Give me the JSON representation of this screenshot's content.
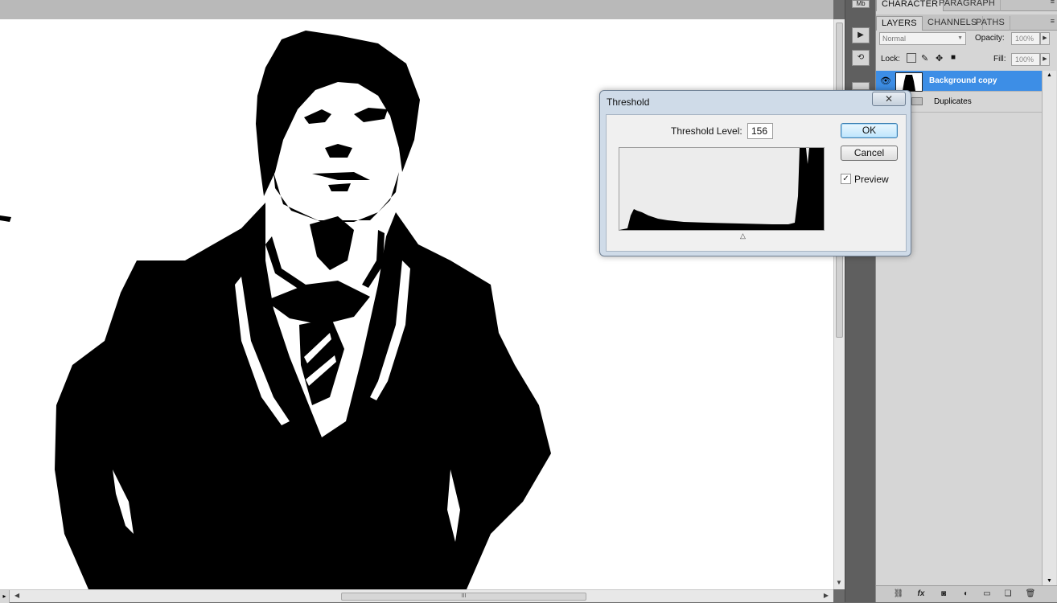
{
  "canvas": {
    "image_description_icon": "portrait-image"
  },
  "dock": {
    "icons": [
      "mini-bridge-icon",
      "play-icon",
      "history-icon",
      "layers-comp-icon"
    ]
  },
  "top_panel": {
    "tabs": [
      "CHARACTER",
      "PARAGRAPH"
    ]
  },
  "layers_panel": {
    "tabs": [
      "LAYERS",
      "CHANNELS",
      "PATHS"
    ],
    "blend_mode": "Normal",
    "opacity_label": "Opacity:",
    "opacity_value": "100%",
    "lock_label": "Lock:",
    "fill_label": "Fill:",
    "fill_value": "100%",
    "layers": [
      {
        "name": "Background copy",
        "selected": true
      },
      {
        "name": "Duplicates",
        "selected": false
      }
    ]
  },
  "dialog": {
    "title": "Threshold",
    "close_glyph": "✕",
    "threshold_label": "Threshold Level:",
    "threshold_value": "156",
    "ok_label": "OK",
    "cancel_label": "Cancel",
    "preview_label": "Preview",
    "preview_checked": true
  },
  "hscroll": {
    "thumb_grip": "III"
  },
  "colors": {
    "selection": "#3d8ee6",
    "panel_bg": "#d6d6d6",
    "workspace": "#6b6b6b"
  }
}
